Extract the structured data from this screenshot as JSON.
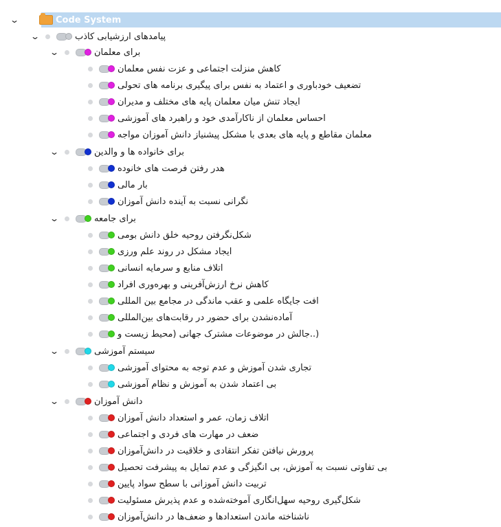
{
  "root": {
    "label": "Code System"
  },
  "group1": {
    "label": "پیامدهای ارزشیابی کاذب",
    "sub_teachers": {
      "label": "برای معلمان",
      "color": "#e020e0",
      "items": [
        "کاهش منزلت اجتماعی و عزت نفس معلمان",
        "تضعیف خودباوری و اعتماد به نفس برای پیگیری برنامه های تحولی",
        "ایجاد تنش میان معلمان پایه های مختلف و مدیران",
        "احساس معلمان از ناکارآمدی خود و راهبرد های آموزشی",
        "معلمان مقاطع و پایه های بعدی با مشکل پیشنیاز دانش آموزان مواجه"
      ]
    },
    "sub_family": {
      "label": "برای خانواده ها و والدین",
      "color": "#1030d0",
      "items": [
        "هدر رفتن فرصت های خانوده",
        "بار مالی",
        "نگرانی نسبت به آینده دانش آموزان"
      ]
    },
    "sub_society": {
      "label": "برای جامعه",
      "color": "#40d020",
      "items": [
        "شکل‌نگرفتن روحیه خلق دانش بومی",
        "ایجاد مشکل در روند علم ورزی",
        "اتلاف منابع و سرمایه انسانی",
        "کاهش نرخ ارزش‌آفرینی و بهره‌وری افراد",
        "افت جایگاه علمی و عقب ماندگی در مجامع بین المللی",
        "آماده‌نشدن برای حضور در رقابت‌های بین‌المللی",
        "(..جالش در موضوعات مشترک جهانی (محیط زیست و"
      ]
    },
    "sub_education": {
      "label": "سیستم آموزشی",
      "color": "#20d8e8",
      "items": [
        "تجاری شدن آموزش و عدم توجه به محتوای آموزشی",
        "بی اعتماد شدن به آموزش و نظام آموزشی"
      ]
    },
    "sub_students": {
      "label": "دانش آموزان",
      "color": "#e02020",
      "items": [
        "اتلاف زمان، عمر و استعداد دانش آموزان",
        "ضعف در مهارت های فردی و اجتماعی",
        "پرورش نیافتن تفکر انتقادی و خلاقیت در دانش‌آموزان",
        "بی تفاوتی نسبت به آموزش، بی انگیزگی و عدم تمایل به پیشرفت تحصیل",
        "تربیت دانش آموزانی با سطح سواد پایین",
        "شکل‌گیری روحیه سهل‌انگاری آموخته‌شده و عدم پذیرش مسئولیت",
        "ناشناخته ماندن استعدادها و ضعف‌ها در دانش‌آموزان"
      ]
    }
  },
  "icons": {
    "expand": "chevron-down-icon",
    "code": "code-icon",
    "folder": "folder-icon"
  }
}
